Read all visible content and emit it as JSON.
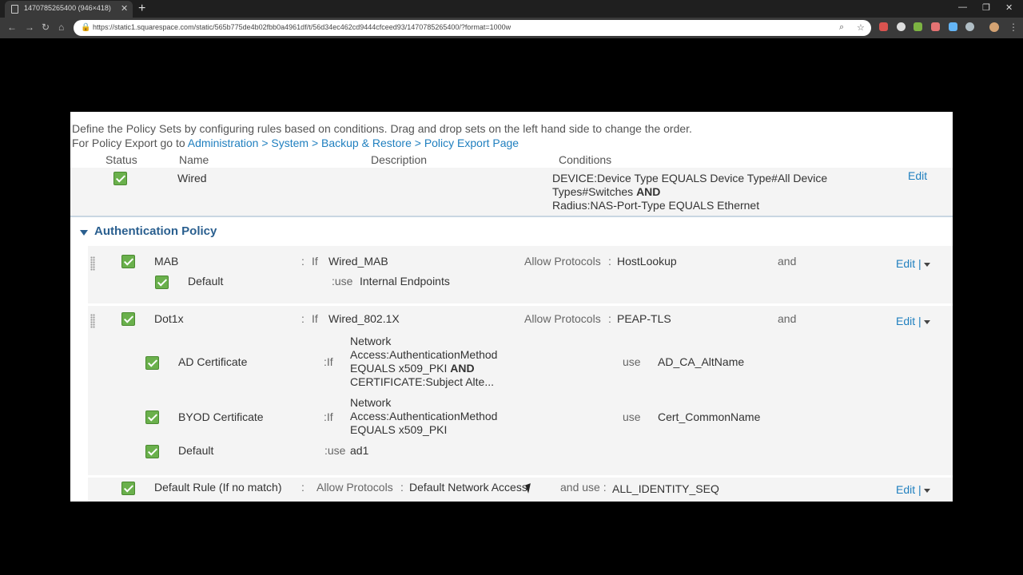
{
  "browser": {
    "tab_title": "1470785265400 (946×418)",
    "url": "https://static1.squarespace.com/static/565b775de4b02fbb0a4961df/t/56d34ec462cd9444cfceed93/1470785265400/?format=1000w"
  },
  "intro": {
    "line1": "Define the Policy Sets by configuring rules based on conditions. Drag and drop sets on the left hand side to change the order.",
    "line2_prefix": "For Policy Export go to ",
    "line2_link": "Administration > System > Backup & Restore > Policy Export Page"
  },
  "policy_set": {
    "headers": {
      "status": "Status",
      "name": "Name",
      "description": "Description",
      "conditions": "Conditions"
    },
    "name": "Wired",
    "conditions_line1": "DEVICE:Device Type EQUALS Device Type#All Device",
    "conditions_line2": "Types#Switches",
    "conditions_and": "AND",
    "conditions_line3": "Radius:NAS-Port-Type EQUALS Ethernet",
    "edit": "Edit"
  },
  "auth": {
    "title": "Authentication Policy",
    "mab": {
      "name": "MAB",
      "colon": ":",
      "if": "If",
      "condition": "Wired_MAB",
      "allow_label": "Allow Protocols",
      "allow_colon": ":",
      "protocol": "HostLookup",
      "and": "and",
      "edit": "Edit |",
      "default_name": "Default",
      "default_use": ":use",
      "default_store": "Internal Endpoints"
    },
    "dot1x": {
      "name": "Dot1x",
      "colon": ":",
      "if": "If",
      "condition": "Wired_802.1X",
      "allow_label": "Allow Protocols",
      "allow_colon": ":",
      "protocol": "PEAP-TLS",
      "and": "and",
      "edit": "Edit |",
      "rules": [
        {
          "name": "AD Certificate",
          "if": ":If",
          "cond1": "Network",
          "cond2": "Access:AuthenticationMethod",
          "cond3": "EQUALS x509_PKI",
          "cond_and": "AND",
          "cond4": "CERTIFICATE:Subject Alte...",
          "use": "use",
          "store": "AD_CA_AltName"
        },
        {
          "name": "BYOD Certificate",
          "if": ":If",
          "cond1": "Network",
          "cond2": "Access:AuthenticationMethod",
          "cond3": "EQUALS x509_PKI",
          "use": "use",
          "store": "Cert_CommonName"
        },
        {
          "name": "Default",
          "use": ":use",
          "store": "ad1"
        }
      ]
    },
    "default_rule": {
      "name": "Default Rule (If no match)",
      "colon": ":",
      "allow_label": "Allow Protocols",
      "allow_colon": ":",
      "protocol": "Default Network Access",
      "and_use": "and use :",
      "store": "ALL_IDENTITY_SEQ",
      "edit": "Edit |"
    }
  }
}
